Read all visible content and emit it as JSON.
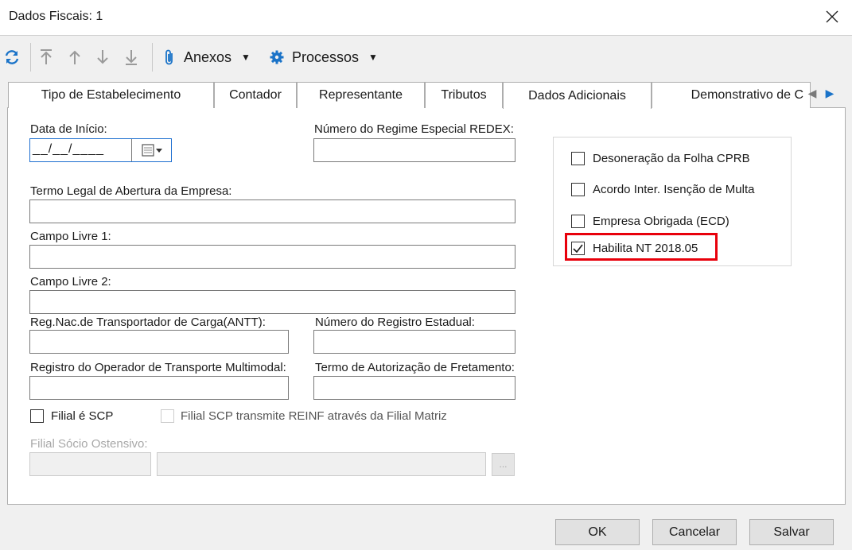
{
  "window": {
    "title": "Dados Fiscais: 1"
  },
  "toolbar": {
    "anexos_label": "Anexos",
    "processos_label": "Processos"
  },
  "tabs": [
    "Tipo de Estabelecimento",
    "Contador",
    "Representante",
    "Tributos",
    "Dados Adicionais",
    "Demonstrativo de C"
  ],
  "form": {
    "data_inicio_label": "Data de Início:",
    "data_inicio_value": "__/__/____",
    "regime_redex_label": "Número do Regime Especial REDEX:",
    "termo_legal_label": "Termo Legal de Abertura da Empresa:",
    "campo_livre1_label": "Campo Livre 1:",
    "campo_livre2_label": "Campo Livre 2:",
    "antt_label": "Reg.Nac.de Transportador de Carga(ANTT):",
    "registro_estadual_label": "Número do Registro Estadual:",
    "operador_multimodal_label": "Registro do Operador de Transporte Multimodal:",
    "termo_fretamento_label": "Termo de Autorização de Fretamento:",
    "filial_scp_label": "Filial é SCP",
    "filial_scp_reinf_label": "Filial SCP transmite REINF através da Filial Matriz",
    "filial_socio_label": "Filial Sócio Ostensivo:",
    "ellipsis_label": "..."
  },
  "options": {
    "desoneracao_label": "Desoneração da Folha CPRB",
    "acordo_label": "Acordo Inter. Isenção de Multa",
    "empresa_ecd_label": "Empresa Obrigada (ECD)",
    "habilita_nt_label": "Habilita NT 2018.05",
    "habilita_nt_checked": true
  },
  "buttons": {
    "ok": "OK",
    "cancelar": "Cancelar",
    "salvar": "Salvar"
  },
  "colors": {
    "highlight": "#e8000b",
    "icon_blue": "#1a73c8"
  }
}
